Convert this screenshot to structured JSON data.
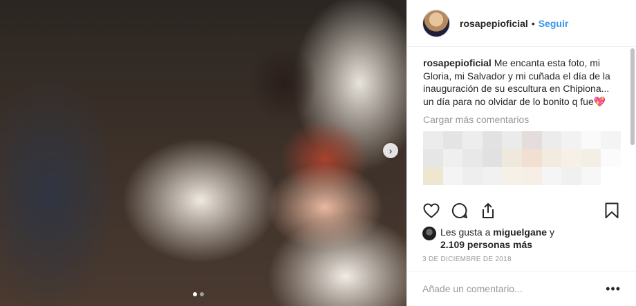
{
  "post": {
    "username": "rosapepioficial",
    "separator": "•",
    "follow_label": "Seguir",
    "caption_username": "rosapepioficial",
    "caption_text": "Me encanta esta foto, mi Gloria, mi Salvador y mi cuñada el día de la inauguración de su escultura en Chipiona... un día para no olvidar de lo bonito q fue",
    "caption_emoji": "💖",
    "load_more": "Cargar más comentarios",
    "likes_prefix": "Les gusta a",
    "likes_user": "miguelgane",
    "likes_and": "y",
    "likes_count": "2.109 personas más",
    "date": "3 DE DICIEMBRE DE 2018",
    "add_comment_placeholder": "Añade un comentario...",
    "more_options": "•••",
    "next_arrow": "›"
  },
  "carousel": {
    "total": 2,
    "active": 1
  },
  "colors": {
    "link_blue": "#3897f0",
    "text": "#262626",
    "muted": "#999999",
    "border": "#efefef"
  },
  "icons": [
    "heart-icon",
    "comment-icon",
    "share-icon",
    "bookmark-icon",
    "chevron-right-icon"
  ]
}
